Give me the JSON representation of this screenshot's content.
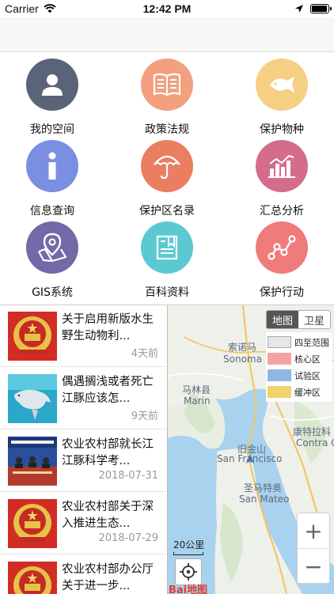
{
  "status_bar": {
    "carrier": "Carrier",
    "time": "12:42 PM",
    "battery_percent": 95
  },
  "menu": [
    {
      "label": "我的空间",
      "icon": "user-icon",
      "color": "#5a6478"
    },
    {
      "label": "政策法规",
      "icon": "book-icon",
      "color": "#f2a07e"
    },
    {
      "label": "保护物种",
      "icon": "fish-icon",
      "color": "#f5cf84"
    },
    {
      "label": "信息查询",
      "icon": "info-icon",
      "color": "#7a8fe2"
    },
    {
      "label": "保护区名录",
      "icon": "umbrella-icon",
      "color": "#eb7e61"
    },
    {
      "label": "汇总分析",
      "icon": "bar-chart-icon",
      "color": "#d56c8c"
    },
    {
      "label": "GIS系统",
      "icon": "map-pin-icon",
      "color": "#7468a8"
    },
    {
      "label": "百科资料",
      "icon": "encyclopedia-icon",
      "color": "#5cc9d2"
    },
    {
      "label": "保护行动",
      "icon": "line-chart-icon",
      "color": "#ef7b7b"
    }
  ],
  "news": [
    {
      "title": "关于启用新版水生野生动物利...",
      "date": "4天前",
      "thumb": "national-emblem"
    },
    {
      "title": "偶遇搁浅或者死亡江豚应该怎...",
      "date": "9天前",
      "thumb": "porpoise-photo"
    },
    {
      "title": "农业农村部就长江江豚科学考...",
      "date": "2018-07-31",
      "thumb": "press-conference-photo"
    },
    {
      "title": "农业农村部关于深入推进生态...",
      "date": "2018-07-29",
      "thumb": "national-emblem"
    },
    {
      "title": "农业农村部办公厅关于进一步...",
      "date": "",
      "thumb": "national-emblem"
    }
  ],
  "map": {
    "toggle": {
      "map_label": "地图",
      "satellite_label": "卫星"
    },
    "legend": [
      {
        "label": "四至范围",
        "color": "#e6e6e6"
      },
      {
        "label": "核心区",
        "color": "#f4a3a3"
      },
      {
        "label": "试验区",
        "color": "#8db8e6"
      },
      {
        "label": "缓冲区",
        "color": "#f2d36b"
      }
    ],
    "places": [
      {
        "name": "索诺马"
      },
      {
        "name": "Sonoma"
      },
      {
        "name": "马林县"
      },
      {
        "name": "Marin"
      },
      {
        "name": "旧金山"
      },
      {
        "name": "San Francisco"
      },
      {
        "name": "圣马特奥"
      },
      {
        "name": "San Mateo"
      },
      {
        "name": "康特拉科"
      },
      {
        "name": "Contra C"
      },
      {
        "name": "萨"
      },
      {
        "name": "Sa"
      }
    ],
    "scale_label": "20公里",
    "zoom_in": "+",
    "zoom_out": "−",
    "logo": "Bai地图"
  }
}
